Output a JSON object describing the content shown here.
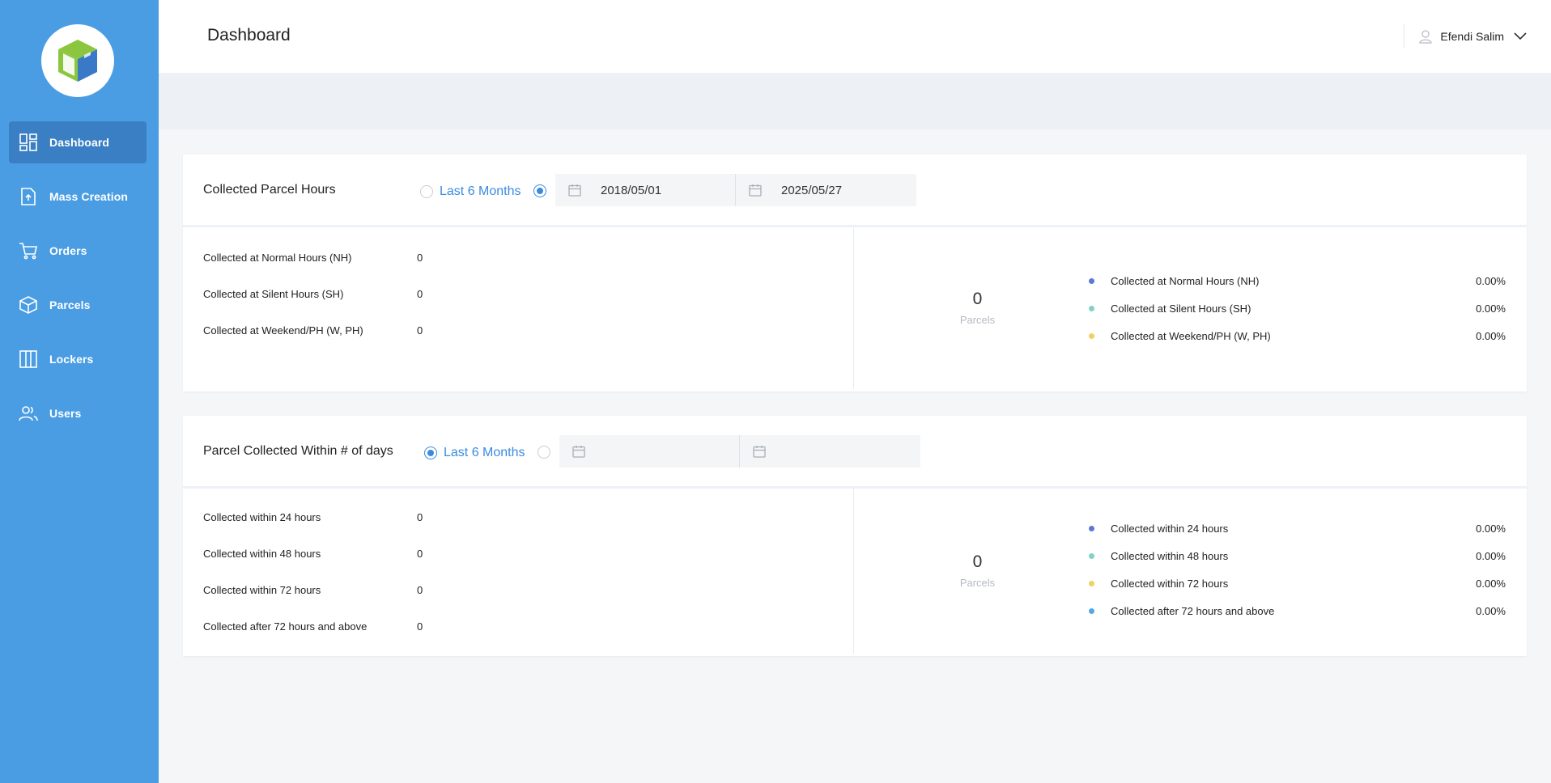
{
  "sidebar": {
    "items": [
      {
        "label": "Dashboard",
        "icon": "dashboard-icon"
      },
      {
        "label": "Mass Creation",
        "icon": "upload-file-icon"
      },
      {
        "label": "Orders",
        "icon": "cart-icon"
      },
      {
        "label": "Parcels",
        "icon": "box-icon"
      },
      {
        "label": "Lockers",
        "icon": "locker-icon"
      },
      {
        "label": "Users",
        "icon": "users-icon"
      }
    ]
  },
  "header": {
    "title": "Dashboard",
    "user_name": "Efendi Salim"
  },
  "colors": {
    "sidebar": "#4a9de3",
    "active_nav": "#3a7fc3",
    "accent": "#3a8be0",
    "dot_blue": "#5b78d6",
    "dot_teal": "#84d0c9",
    "dot_yellow": "#f0d060",
    "dot_lightblue": "#55a7e0"
  },
  "card1": {
    "title": "Collected Parcel Hours",
    "radio_label": "Last 6 Months",
    "selected": "date-range",
    "date_from": "2018/05/01",
    "date_to": "2025/05/27",
    "stats": [
      {
        "label": "Collected at Normal Hours (NH)",
        "value": "0"
      },
      {
        "label": "Collected at Silent Hours (SH)",
        "value": "0"
      },
      {
        "label": "Collected at Weekend/PH (W, PH)",
        "value": "0"
      }
    ],
    "total": "0",
    "total_unit": "Parcels",
    "legend": [
      {
        "label": "Collected at Normal Hours (NH)",
        "pct": "0.00%"
      },
      {
        "label": "Collected at Silent Hours (SH)",
        "pct": "0.00%"
      },
      {
        "label": "Collected at Weekend/PH (W, PH)",
        "pct": "0.00%"
      }
    ]
  },
  "card2": {
    "title": "Parcel Collected Within # of days",
    "radio_label": "Last 6 Months",
    "selected": "last-6-months",
    "date_from": "",
    "date_to": "",
    "stats": [
      {
        "label": "Collected within 24 hours",
        "value": "0"
      },
      {
        "label": "Collected within 48 hours",
        "value": "0"
      },
      {
        "label": "Collected within 72 hours",
        "value": "0"
      },
      {
        "label": "Collected after 72 hours and above",
        "value": "0"
      }
    ],
    "total": "0",
    "total_unit": "Parcels",
    "legend": [
      {
        "label": "Collected within 24 hours",
        "pct": "0.00%"
      },
      {
        "label": "Collected within 48 hours",
        "pct": "0.00%"
      },
      {
        "label": "Collected within 72 hours",
        "pct": "0.00%"
      },
      {
        "label": "Collected after 72 hours and above",
        "pct": "0.00%"
      }
    ]
  }
}
